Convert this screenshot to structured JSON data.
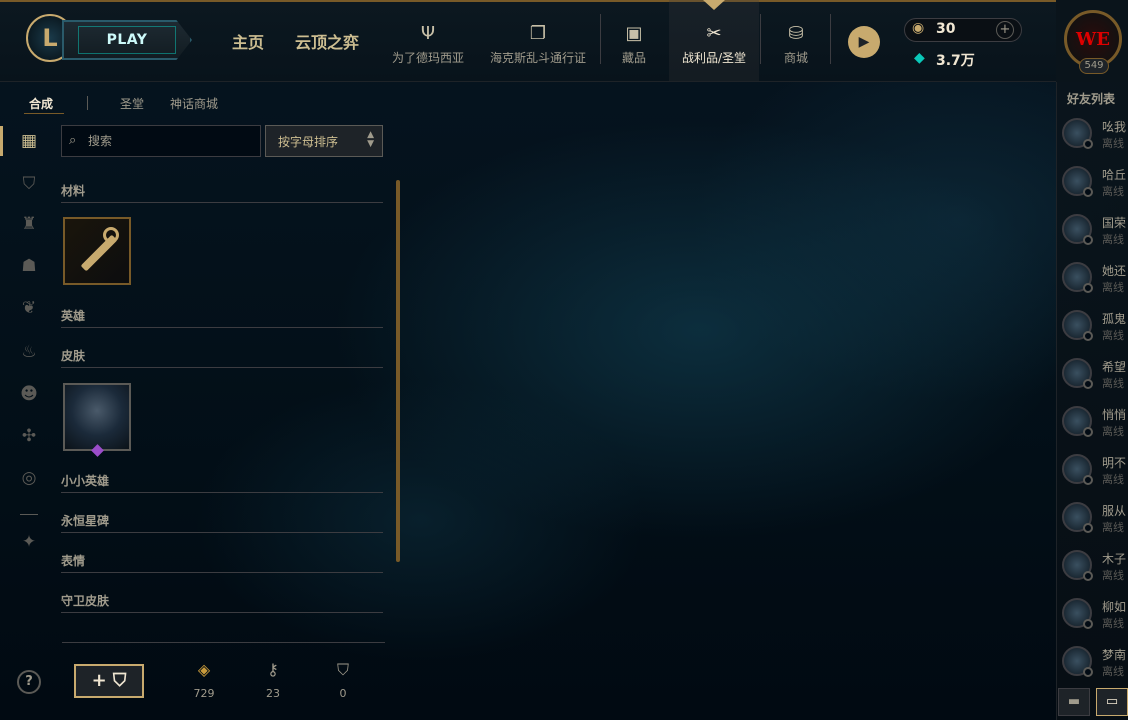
{
  "nav": {
    "play_label": "PLAY",
    "main_items": [
      {
        "label": "主页"
      },
      {
        "label": "云顶之弈"
      }
    ],
    "icon_items": [
      {
        "label": "为了德玛西亚",
        "icon": "trident-icon"
      },
      {
        "label": "海克斯乱斗通行证",
        "icon": "cards-icon"
      },
      {
        "label": "藏品",
        "icon": "bag-icon"
      },
      {
        "label": "战利品/圣堂",
        "icon": "loot-icon"
      },
      {
        "label": "商城",
        "icon": "coins-icon"
      }
    ],
    "active_item": "战利品/圣堂",
    "rp": "30",
    "blue_essence": "3.7万",
    "level": "549",
    "avatar_text": "WE"
  },
  "subtabs": [
    {
      "label": "合成"
    },
    {
      "label": "圣堂"
    },
    {
      "label": "神话商城"
    }
  ],
  "search": {
    "placeholder": "搜索",
    "value": ""
  },
  "sort": {
    "selected": "按字母排序"
  },
  "categories": [
    {
      "label": "材料"
    },
    {
      "label": "英雄"
    },
    {
      "label": "皮肤"
    },
    {
      "label": "小小英雄"
    },
    {
      "label": "永恒星碑"
    },
    {
      "label": "表情"
    },
    {
      "label": "守卫皮肤"
    }
  ],
  "bottom": {
    "add_label": "+",
    "resources": [
      {
        "icon": "orange-essence-icon",
        "value": "729"
      },
      {
        "icon": "key-icon",
        "value": "23"
      },
      {
        "icon": "chest-icon",
        "value": "0"
      }
    ]
  },
  "friends": {
    "title": "好友列表",
    "list": [
      {
        "name": "吆我",
        "status": "离线"
      },
      {
        "name": "哈丘",
        "status": "离线"
      },
      {
        "name": "国荣",
        "status": "离线"
      },
      {
        "name": "她还",
        "status": "离线"
      },
      {
        "name": "孤鬼",
        "status": "离线"
      },
      {
        "name": "希望",
        "status": "离线"
      },
      {
        "name": "悄悄",
        "status": "离线"
      },
      {
        "name": "明不",
        "status": "离线"
      },
      {
        "name": "服从",
        "status": "离线"
      },
      {
        "name": "木子",
        "status": "离线"
      },
      {
        "name": "柳如",
        "status": "离线"
      },
      {
        "name": "梦南",
        "status": "离线"
      }
    ]
  },
  "colors": {
    "gold": "#c8aa6e",
    "teal": "#0ac8b9",
    "bg": "#010a13"
  }
}
